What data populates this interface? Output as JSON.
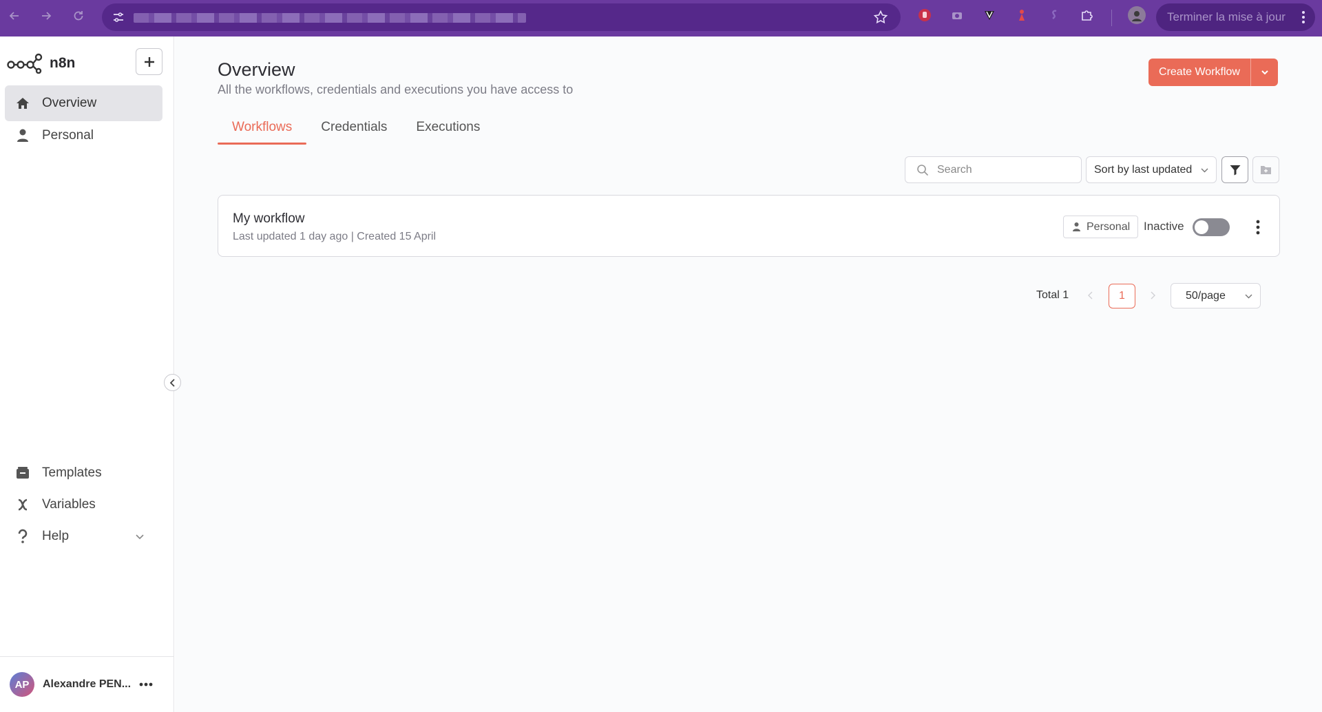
{
  "browser": {
    "update_label": "Terminer la mise à jour"
  },
  "app": {
    "name": "n8n"
  },
  "sidebar": {
    "items": [
      {
        "label": "Overview",
        "icon": "home-icon"
      },
      {
        "label": "Personal",
        "icon": "user-icon"
      }
    ],
    "bottom_items": [
      {
        "label": "Templates",
        "icon": "templates-icon"
      },
      {
        "label": "Variables",
        "icon": "variables-icon"
      },
      {
        "label": "Help",
        "icon": "help-icon"
      }
    ],
    "user": {
      "initials": "AP",
      "name": "Alexandre PEN..."
    }
  },
  "header": {
    "title": "Overview",
    "subtitle": "All the workflows, credentials and executions you have access to",
    "create_button": "Create Workflow"
  },
  "tabs": [
    {
      "label": "Workflows",
      "active": true
    },
    {
      "label": "Credentials",
      "active": false
    },
    {
      "label": "Executions",
      "active": false
    }
  ],
  "toolbar": {
    "search_placeholder": "Search",
    "sort_label": "Sort by last updated"
  },
  "workflows": [
    {
      "name": "My workflow",
      "meta": "Last updated 1 day ago | Created 15 April",
      "owner": "Personal",
      "status": "Inactive",
      "active": false
    }
  ],
  "pagination": {
    "total": "Total 1",
    "current_page": "1",
    "per_page": "50/page"
  },
  "colors": {
    "accent": "#ea6b57",
    "chrome": "#6a3a9f"
  }
}
